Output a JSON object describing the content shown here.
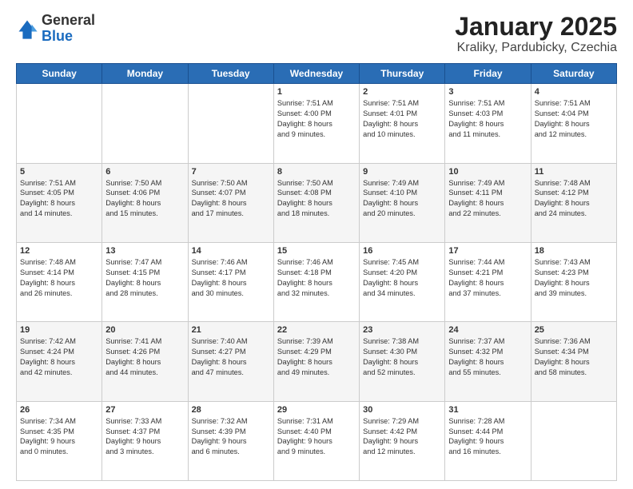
{
  "header": {
    "logo_general": "General",
    "logo_blue": "Blue",
    "title": "January 2025",
    "subtitle": "Kraliky, Pardubicky, Czechia"
  },
  "days_of_week": [
    "Sunday",
    "Monday",
    "Tuesday",
    "Wednesday",
    "Thursday",
    "Friday",
    "Saturday"
  ],
  "weeks": [
    [
      {
        "day": "",
        "info": ""
      },
      {
        "day": "",
        "info": ""
      },
      {
        "day": "",
        "info": ""
      },
      {
        "day": "1",
        "info": "Sunrise: 7:51 AM\nSunset: 4:00 PM\nDaylight: 8 hours\nand 9 minutes."
      },
      {
        "day": "2",
        "info": "Sunrise: 7:51 AM\nSunset: 4:01 PM\nDaylight: 8 hours\nand 10 minutes."
      },
      {
        "day": "3",
        "info": "Sunrise: 7:51 AM\nSunset: 4:03 PM\nDaylight: 8 hours\nand 11 minutes."
      },
      {
        "day": "4",
        "info": "Sunrise: 7:51 AM\nSunset: 4:04 PM\nDaylight: 8 hours\nand 12 minutes."
      }
    ],
    [
      {
        "day": "5",
        "info": "Sunrise: 7:51 AM\nSunset: 4:05 PM\nDaylight: 8 hours\nand 14 minutes."
      },
      {
        "day": "6",
        "info": "Sunrise: 7:50 AM\nSunset: 4:06 PM\nDaylight: 8 hours\nand 15 minutes."
      },
      {
        "day": "7",
        "info": "Sunrise: 7:50 AM\nSunset: 4:07 PM\nDaylight: 8 hours\nand 17 minutes."
      },
      {
        "day": "8",
        "info": "Sunrise: 7:50 AM\nSunset: 4:08 PM\nDaylight: 8 hours\nand 18 minutes."
      },
      {
        "day": "9",
        "info": "Sunrise: 7:49 AM\nSunset: 4:10 PM\nDaylight: 8 hours\nand 20 minutes."
      },
      {
        "day": "10",
        "info": "Sunrise: 7:49 AM\nSunset: 4:11 PM\nDaylight: 8 hours\nand 22 minutes."
      },
      {
        "day": "11",
        "info": "Sunrise: 7:48 AM\nSunset: 4:12 PM\nDaylight: 8 hours\nand 24 minutes."
      }
    ],
    [
      {
        "day": "12",
        "info": "Sunrise: 7:48 AM\nSunset: 4:14 PM\nDaylight: 8 hours\nand 26 minutes."
      },
      {
        "day": "13",
        "info": "Sunrise: 7:47 AM\nSunset: 4:15 PM\nDaylight: 8 hours\nand 28 minutes."
      },
      {
        "day": "14",
        "info": "Sunrise: 7:46 AM\nSunset: 4:17 PM\nDaylight: 8 hours\nand 30 minutes."
      },
      {
        "day": "15",
        "info": "Sunrise: 7:46 AM\nSunset: 4:18 PM\nDaylight: 8 hours\nand 32 minutes."
      },
      {
        "day": "16",
        "info": "Sunrise: 7:45 AM\nSunset: 4:20 PM\nDaylight: 8 hours\nand 34 minutes."
      },
      {
        "day": "17",
        "info": "Sunrise: 7:44 AM\nSunset: 4:21 PM\nDaylight: 8 hours\nand 37 minutes."
      },
      {
        "day": "18",
        "info": "Sunrise: 7:43 AM\nSunset: 4:23 PM\nDaylight: 8 hours\nand 39 minutes."
      }
    ],
    [
      {
        "day": "19",
        "info": "Sunrise: 7:42 AM\nSunset: 4:24 PM\nDaylight: 8 hours\nand 42 minutes."
      },
      {
        "day": "20",
        "info": "Sunrise: 7:41 AM\nSunset: 4:26 PM\nDaylight: 8 hours\nand 44 minutes."
      },
      {
        "day": "21",
        "info": "Sunrise: 7:40 AM\nSunset: 4:27 PM\nDaylight: 8 hours\nand 47 minutes."
      },
      {
        "day": "22",
        "info": "Sunrise: 7:39 AM\nSunset: 4:29 PM\nDaylight: 8 hours\nand 49 minutes."
      },
      {
        "day": "23",
        "info": "Sunrise: 7:38 AM\nSunset: 4:30 PM\nDaylight: 8 hours\nand 52 minutes."
      },
      {
        "day": "24",
        "info": "Sunrise: 7:37 AM\nSunset: 4:32 PM\nDaylight: 8 hours\nand 55 minutes."
      },
      {
        "day": "25",
        "info": "Sunrise: 7:36 AM\nSunset: 4:34 PM\nDaylight: 8 hours\nand 58 minutes."
      }
    ],
    [
      {
        "day": "26",
        "info": "Sunrise: 7:34 AM\nSunset: 4:35 PM\nDaylight: 9 hours\nand 0 minutes."
      },
      {
        "day": "27",
        "info": "Sunrise: 7:33 AM\nSunset: 4:37 PM\nDaylight: 9 hours\nand 3 minutes."
      },
      {
        "day": "28",
        "info": "Sunrise: 7:32 AM\nSunset: 4:39 PM\nDaylight: 9 hours\nand 6 minutes."
      },
      {
        "day": "29",
        "info": "Sunrise: 7:31 AM\nSunset: 4:40 PM\nDaylight: 9 hours\nand 9 minutes."
      },
      {
        "day": "30",
        "info": "Sunrise: 7:29 AM\nSunset: 4:42 PM\nDaylight: 9 hours\nand 12 minutes."
      },
      {
        "day": "31",
        "info": "Sunrise: 7:28 AM\nSunset: 4:44 PM\nDaylight: 9 hours\nand 16 minutes."
      },
      {
        "day": "",
        "info": ""
      }
    ]
  ]
}
